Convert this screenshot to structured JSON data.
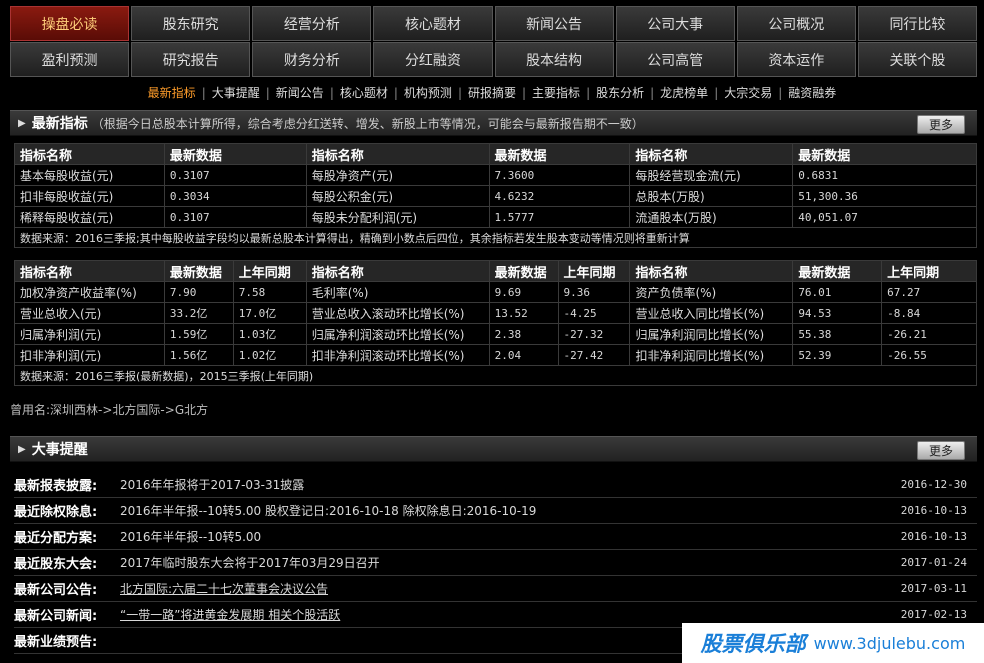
{
  "nav": {
    "row1": [
      "操盘必读",
      "股东研究",
      "经营分析",
      "核心题材",
      "新闻公告",
      "公司大事",
      "公司概况",
      "同行比较"
    ],
    "row2": [
      "盈利预测",
      "研究报告",
      "财务分析",
      "分红融资",
      "股本结构",
      "公司高管",
      "资本运作",
      "关联个股"
    ],
    "active": "操盘必读"
  },
  "sublinks": [
    "最新指标",
    "大事提醒",
    "新闻公告",
    "核心题材",
    "机构预测",
    "研报摘要",
    "主要指标",
    "股东分析",
    "龙虎榜单",
    "大宗交易",
    "融资融券"
  ],
  "section1": {
    "title": "最新指标",
    "note": "（根据今日总股本计算所得，综合考虑分红送转、增发、新股上市等情况，可能会与最新报告期不一致）",
    "more": "更多"
  },
  "table1": {
    "headers": [
      "指标名称",
      "最新数据",
      "指标名称",
      "最新数据",
      "指标名称",
      "最新数据"
    ],
    "rows": [
      [
        "基本每股收益(元)",
        "0.3107",
        "每股净资产(元)",
        "7.3600",
        "每股经营现金流(元)",
        "0.6831"
      ],
      [
        "扣非每股收益(元)",
        "0.3034",
        "每股公积金(元)",
        "4.6232",
        "总股本(万股)",
        "51,300.36"
      ],
      [
        "稀释每股收益(元)",
        "0.3107",
        "每股未分配利润(元)",
        "1.5777",
        "流通股本(万股)",
        "40,051.07"
      ]
    ],
    "footnote": "数据来源：2016三季报;其中每股收益字段均以最新总股本计算得出，精确到小数点后四位，其余指标若发生股本变动等情况则将重新计算"
  },
  "table2": {
    "headers": [
      "指标名称",
      "最新数据",
      "上年同期",
      "指标名称",
      "最新数据",
      "上年同期",
      "指标名称",
      "最新数据",
      "上年同期"
    ],
    "rows": [
      [
        "加权净资产收益率(%)",
        "7.90",
        "7.58",
        "毛利率(%)",
        "9.69",
        "9.36",
        "资产负债率(%)",
        "76.01",
        "67.27"
      ],
      [
        "营业总收入(元)",
        "33.2亿",
        "17.0亿",
        "营业总收入滚动环比增长(%)",
        "13.52",
        "-4.25",
        "营业总收入同比增长(%)",
        "94.53",
        "-8.84"
      ],
      [
        "归属净利润(元)",
        "1.59亿",
        "1.03亿",
        "归属净利润滚动环比增长(%)",
        "2.38",
        "-27.32",
        "归属净利润同比增长(%)",
        "55.38",
        "-26.21"
      ],
      [
        "扣非净利润(元)",
        "1.56亿",
        "1.02亿",
        "扣非净利润滚动环比增长(%)",
        "2.04",
        "-27.42",
        "扣非净利润同比增长(%)",
        "52.39",
        "-26.55"
      ]
    ],
    "footnote": "数据来源：2016三季报(最新数据)，2015三季报(上年同期)"
  },
  "alias": "曾用名:深圳西林->北方国际->G北方",
  "section2": {
    "title": "大事提醒",
    "more": "更多"
  },
  "events": [
    {
      "label": "最新报表披露:",
      "text": "2016年年报将于2017-03-31披露",
      "date": "2016-12-30",
      "link": false
    },
    {
      "label": "最近除权除息:",
      "text": "2016年半年报--10转5.00  股权登记日:2016-10-18  除权除息日:2016-10-19",
      "date": "2016-10-13",
      "link": false
    },
    {
      "label": "最近分配方案:",
      "text": "2016年半年报--10转5.00",
      "date": "2016-10-13",
      "link": false
    },
    {
      "label": "最近股东大会:",
      "text": "2017年临时股东大会将于2017年03月29日召开",
      "date": "2017-01-24",
      "link": false
    },
    {
      "label": "最新公司公告:",
      "text": "北方国际:六届二十七次董事会决议公告",
      "date": "2017-03-11",
      "link": true
    },
    {
      "label": "最新公司新闻:",
      "text": "“一带一路”将进黄金发展期 相关个股活跃",
      "date": "2017-02-13",
      "link": true
    },
    {
      "label": "最新业绩预告:",
      "text": "",
      "date": "",
      "link": false
    }
  ],
  "watermark": {
    "brand": "股票俱乐部",
    "url": "www.3djulebu.com"
  }
}
